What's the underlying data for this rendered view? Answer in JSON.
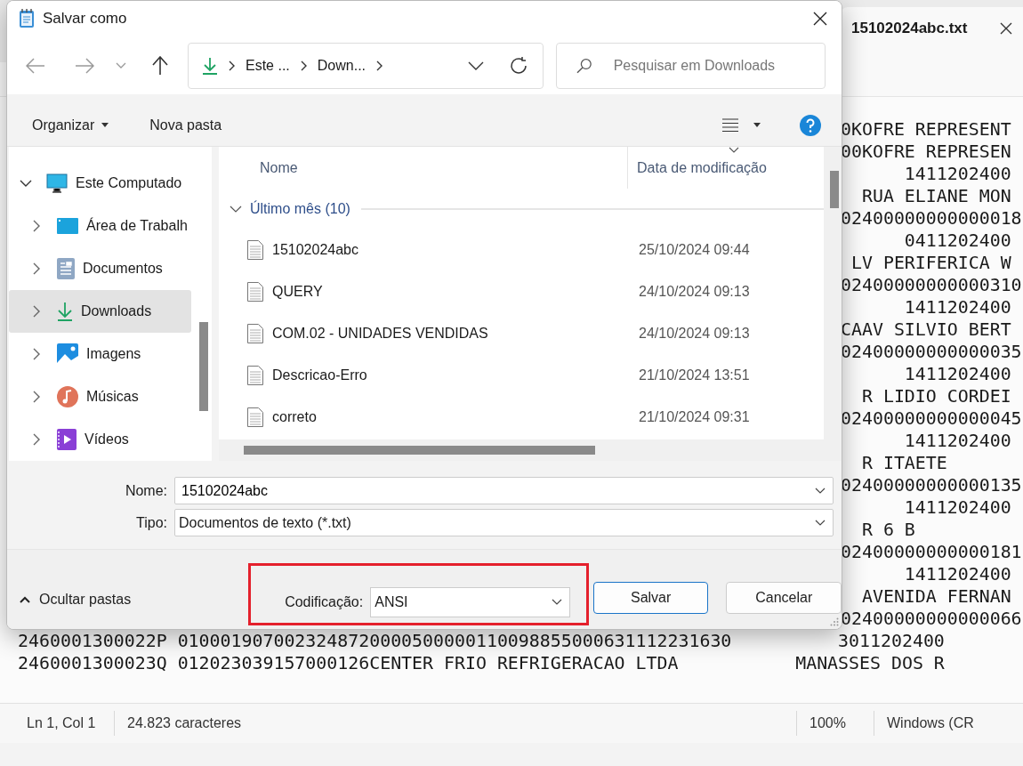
{
  "editor": {
    "tab": {
      "title": "15102024abc.txt"
    },
    "visible_line_ends": [
      "0KOFRE REPRESENT",
      "00KOFRE REPRESEN",
      "      1411202400",
      "  RUA ELIANE MON",
      "02400000000000018",
      "      0411202400",
      " LV PERIFERICA W",
      "02400000000000310",
      "      1411202400",
      "CAAV SILVIO BERT",
      "02400000000000035",
      "      1411202400",
      "  R LIDIO CORDEI",
      "02400000000000045",
      "      1411202400",
      "  R ITAETE",
      "02400000000000135",
      "      1411202400",
      "  R 6 B",
      "02400000000000181",
      "      1411202400",
      "  AVENIDA FERNAN",
      "02400000000000066"
    ],
    "lines": [
      "2460001300022P 0100019070023248720000500000110098855000631112231630          3011202400",
      "2460001300023Q 012023039157000126CENTER FRIO REFRIGERACAO LTDA           MANASSES DOS R"
    ],
    "status_bar": {
      "position": "Ln 1, Col 1",
      "characters": "24.823 caracteres",
      "zoom": "100%",
      "line_ending": "Windows (CR"
    }
  },
  "dialog": {
    "title": "Salvar como",
    "address": {
      "crumbs": [
        "Este ...",
        "Down..."
      ]
    },
    "search": {
      "placeholder": "Pesquisar em Downloads"
    },
    "toolbar": {
      "organize": "Organizar",
      "new_folder": "Nova pasta"
    },
    "nav": [
      {
        "label": "Este Computado",
        "kind": "computer",
        "expanded": true,
        "selected": false,
        "children": [
          {
            "label": "Área de Trabalh",
            "kind": "desktop",
            "expanded": false,
            "selected": false
          },
          {
            "label": "Documentos",
            "kind": "documents",
            "expanded": false,
            "selected": false
          },
          {
            "label": "Downloads",
            "kind": "downloads",
            "expanded": false,
            "selected": true
          },
          {
            "label": "Imagens",
            "kind": "pictures",
            "expanded": false,
            "selected": false
          },
          {
            "label": "Músicas",
            "kind": "music",
            "expanded": false,
            "selected": false
          },
          {
            "label": "Vídeos",
            "kind": "videos",
            "expanded": false,
            "selected": false
          }
        ]
      }
    ],
    "columns": [
      "Nome",
      "Data de modificação"
    ],
    "group": {
      "label": "Último mês (10)",
      "expanded": true
    },
    "files": [
      {
        "name": "15102024abc",
        "modified": "25/10/2024 09:44"
      },
      {
        "name": "QUERY",
        "modified": "24/10/2024 09:13"
      },
      {
        "name": "COM.02 - UNIDADES VENDIDAS",
        "modified": "24/10/2024 09:13"
      },
      {
        "name": "Descricao-Erro",
        "modified": "21/10/2024 13:51"
      },
      {
        "name": "correto",
        "modified": "21/10/2024 09:31"
      }
    ],
    "name_field": {
      "label": "Nome:",
      "value": "15102024abc"
    },
    "type_field": {
      "label": "Tipo:",
      "value": "Documentos de texto (*.txt)"
    },
    "hide_folders": "Ocultar pastas",
    "encoding": {
      "label": "Codificação:",
      "value": "ANSI",
      "highlighted": true
    },
    "buttons": [
      {
        "label": "Salvar",
        "primary": true
      },
      {
        "label": "Cancelar",
        "primary": false
      }
    ]
  }
}
